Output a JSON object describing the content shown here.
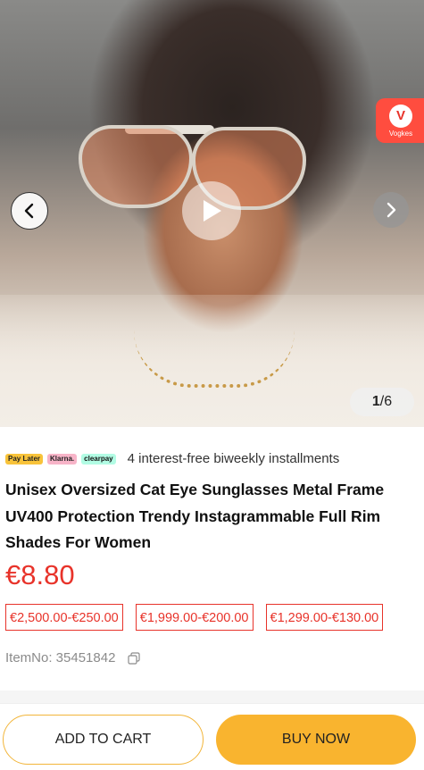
{
  "gallery": {
    "current": "1",
    "total": "/6",
    "badge_letter": "V",
    "badge_label": "Vogkes"
  },
  "payment": {
    "pills": [
      "Pay Later",
      "Klarna.",
      "clearpay"
    ],
    "installments_text": "4 interest-free biweekly installments"
  },
  "product": {
    "title": "Unisex Oversized Cat Eye Sunglasses Metal Frame UV400 Protection Trendy Instagrammable Full Rim Shades For Women",
    "price": "€8.80",
    "tiers": [
      "€2,500.00-€250.00",
      "€1,999.00-€200.00",
      "€1,299.00-€130.00"
    ],
    "item_no_label": "ItemNo: 35451842"
  },
  "actions": {
    "add_to_cart": "ADD TO CART",
    "buy_now": "BUY NOW"
  },
  "colors": {
    "accent_red": "#e8332a",
    "button_yellow": "#f9b42f"
  }
}
